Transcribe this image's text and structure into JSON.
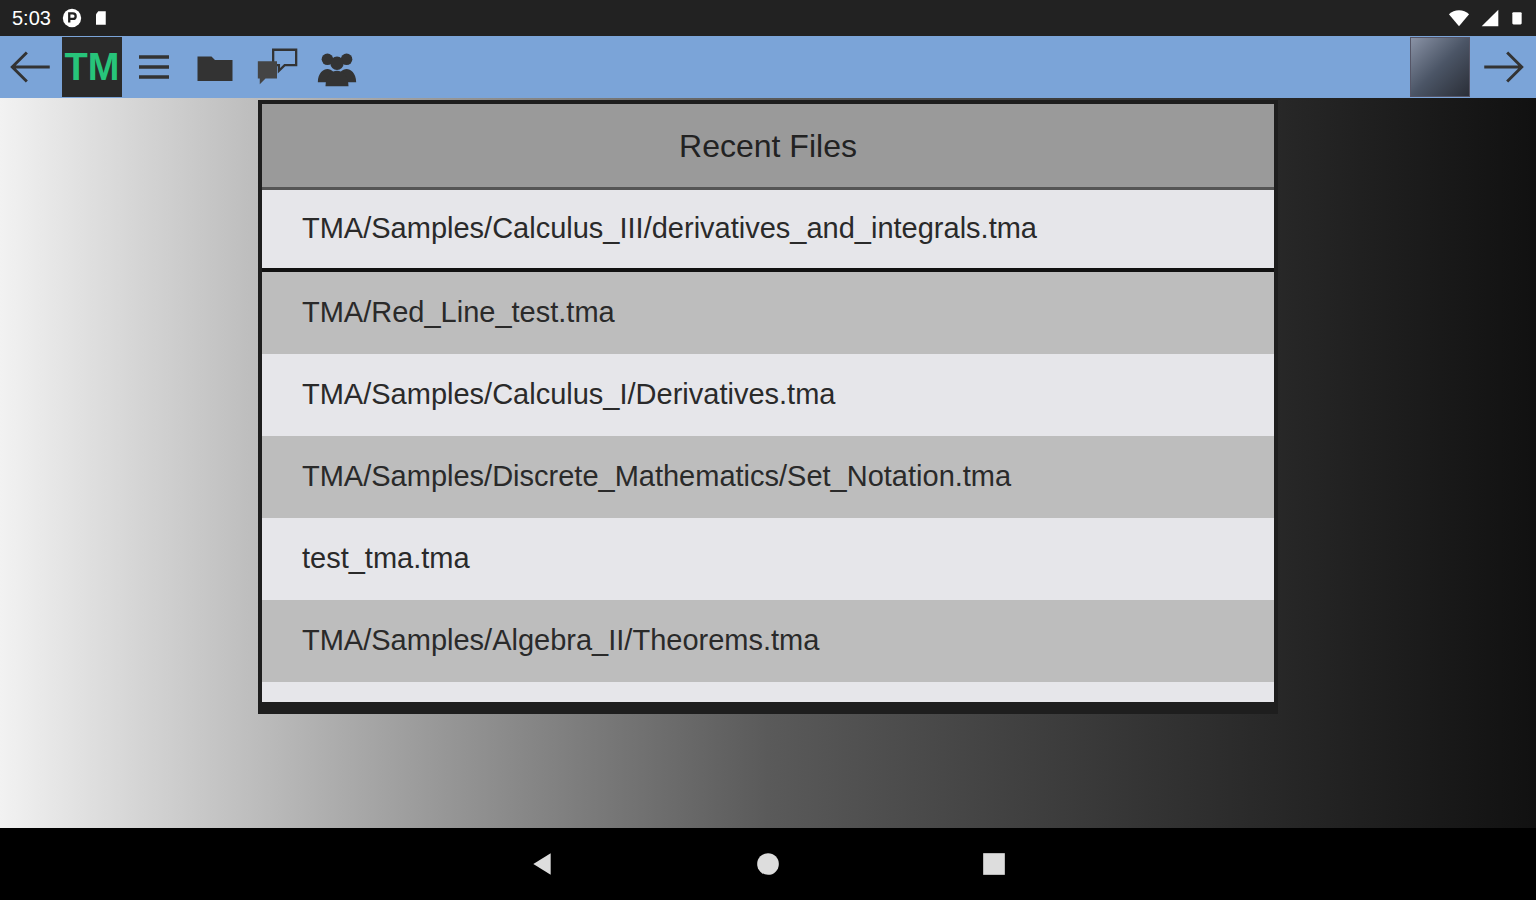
{
  "status_bar": {
    "time": "5:03"
  },
  "toolbar": {
    "logo": "TM"
  },
  "dialog": {
    "title": "Recent Files",
    "files": [
      {
        "path": "TMA/Samples/Calculus_III/derivatives_and_integrals.tma",
        "selected": true
      },
      {
        "path": "TMA/Red_Line_test.tma",
        "selected": false
      },
      {
        "path": "TMA/Samples/Calculus_I/Derivatives.tma",
        "selected": false
      },
      {
        "path": "TMA/Samples/Discrete_Mathematics/Set_Notation.tma",
        "selected": false
      },
      {
        "path": "test_tma.tma",
        "selected": false
      },
      {
        "path": "TMA/Samples/Algebra_II/Theorems.tma",
        "selected": false
      }
    ]
  }
}
